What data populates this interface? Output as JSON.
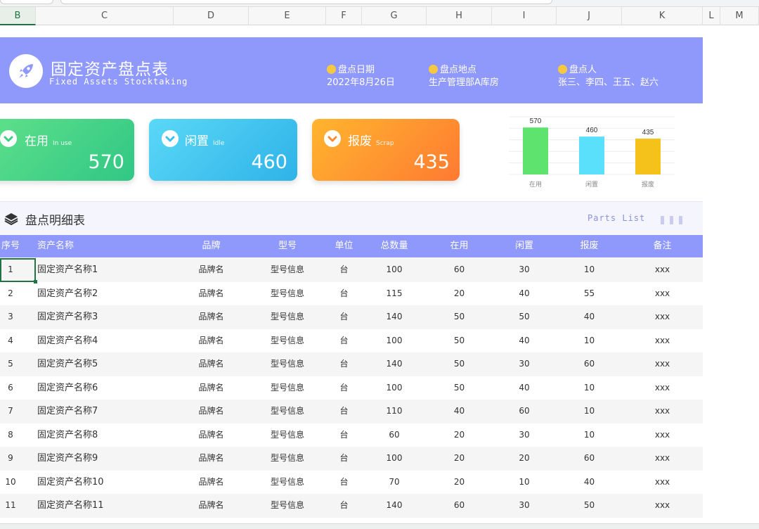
{
  "columns": [
    "B",
    "C",
    "D",
    "E",
    "F",
    "G",
    "H",
    "I",
    "J",
    "K",
    "L",
    "M"
  ],
  "banner": {
    "title": "固定资产盘点表",
    "subtitle": "Fixed Assets Stocktaking",
    "date_label": "盘点日期",
    "date_value": "2022年8月26日",
    "place_label": "盘点地点",
    "place_value": "生产管理部A库房",
    "person_label": "盘点人",
    "person_value": "张三、李四、王五、赵六"
  },
  "cards": [
    {
      "label": "在用",
      "en": "In use",
      "value": "570",
      "color": "#3fcf84"
    },
    {
      "label": "闲置",
      "en": "Idle",
      "value": "460",
      "color": "#3ec0ee"
    },
    {
      "label": "报废",
      "en": "Scrap",
      "value": "435",
      "color": "#ff8a30"
    }
  ],
  "chart_data": {
    "type": "bar",
    "categories": [
      "在用",
      "闲置",
      "报废"
    ],
    "values": [
      570,
      460,
      435
    ],
    "colors": [
      "#5ee36e",
      "#5be0fb",
      "#f5c21c"
    ],
    "data_labels": [
      "570",
      "460",
      "435"
    ],
    "title": "",
    "xlabel": "",
    "ylabel": "",
    "ylim": [
      0,
      700
    ],
    "grid": true
  },
  "section": {
    "title": "盘点明细表",
    "english": "Parts List"
  },
  "table": {
    "headers": [
      "序号",
      "资产名称",
      "品牌",
      "型号",
      "单位",
      "总数量",
      "在用",
      "闲置",
      "报废",
      "备注"
    ],
    "rows": [
      [
        "1",
        "固定资产名称1",
        "品牌名",
        "型号信息",
        "台",
        "100",
        "60",
        "30",
        "10",
        "xxx"
      ],
      [
        "2",
        "固定资产名称2",
        "品牌名",
        "型号信息",
        "台",
        "115",
        "20",
        "40",
        "55",
        "xxx"
      ],
      [
        "3",
        "固定资产名称3",
        "品牌名",
        "型号信息",
        "台",
        "140",
        "50",
        "50",
        "40",
        "xxx"
      ],
      [
        "4",
        "固定资产名称4",
        "品牌名",
        "型号信息",
        "台",
        "100",
        "50",
        "40",
        "10",
        "xxx"
      ],
      [
        "5",
        "固定资产名称5",
        "品牌名",
        "型号信息",
        "台",
        "140",
        "50",
        "30",
        "60",
        "xxx"
      ],
      [
        "6",
        "固定资产名称6",
        "品牌名",
        "型号信息",
        "台",
        "100",
        "50",
        "40",
        "10",
        "xxx"
      ],
      [
        "7",
        "固定资产名称7",
        "品牌名",
        "型号信息",
        "台",
        "110",
        "40",
        "60",
        "10",
        "xxx"
      ],
      [
        "8",
        "固定资产名称8",
        "品牌名",
        "型号信息",
        "台",
        "60",
        "20",
        "30",
        "10",
        "xxx"
      ],
      [
        "9",
        "固定资产名称9",
        "品牌名",
        "型号信息",
        "台",
        "100",
        "20",
        "20",
        "60",
        "xxx"
      ],
      [
        "10",
        "固定资产名称10",
        "品牌名",
        "型号信息",
        "台",
        "70",
        "20",
        "10",
        "40",
        "xxx"
      ],
      [
        "11",
        "固定资产名称11",
        "品牌名",
        "型号信息",
        "台",
        "140",
        "60",
        "30",
        "50",
        "xxx"
      ]
    ]
  }
}
